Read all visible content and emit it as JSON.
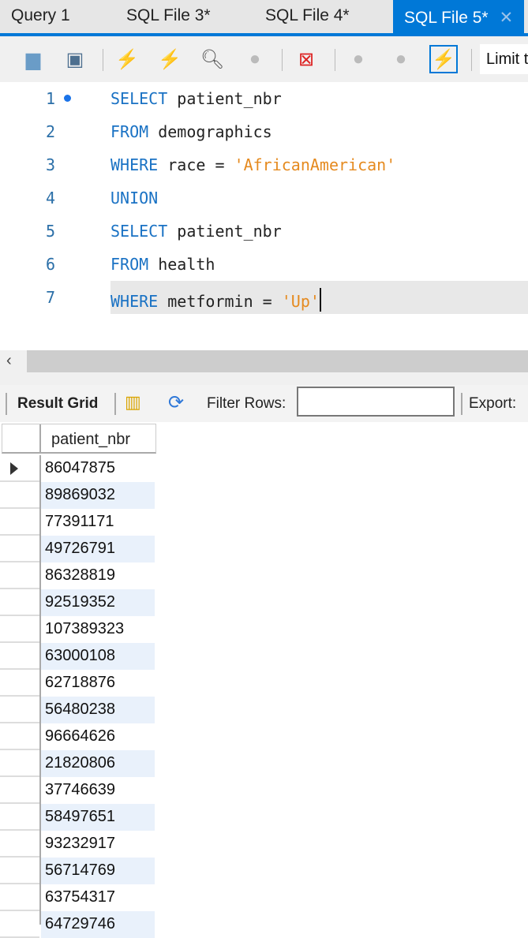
{
  "tabs": [
    {
      "label": "Query 1"
    },
    {
      "label": "SQL File 3*"
    },
    {
      "label": "SQL File 4*"
    },
    {
      "label": "SQL File 5*",
      "active": true
    }
  ],
  "toolbar": {
    "icons": [
      "open-folder-icon",
      "save-icon",
      "execute-icon",
      "execute-current-icon",
      "explain-icon",
      "stop-icon",
      "toggle-error-icon",
      "commit-icon",
      "rollback-icon",
      "autocommit-icon"
    ],
    "limit_label": "Limit t"
  },
  "editor": {
    "lines": [
      {
        "n": "1",
        "tokens": [
          [
            "kw",
            "SELECT"
          ],
          [
            "",
            "patient_nbr"
          ]
        ]
      },
      {
        "n": "2",
        "tokens": [
          [
            "kw",
            "FROM"
          ],
          [
            "",
            "demographics"
          ]
        ]
      },
      {
        "n": "3",
        "tokens": [
          [
            "kw",
            "WHERE"
          ],
          [
            "",
            "race ="
          ],
          [
            "str",
            "'AfricanAmerican'"
          ]
        ]
      },
      {
        "n": "4",
        "tokens": [
          [
            "kw",
            "UNION"
          ]
        ]
      },
      {
        "n": "5",
        "tokens": [
          [
            "kw",
            "SELECT"
          ],
          [
            "",
            "patient_nbr"
          ]
        ]
      },
      {
        "n": "6",
        "tokens": [
          [
            "kw",
            "FROM"
          ],
          [
            "",
            "health"
          ]
        ]
      },
      {
        "n": "7",
        "tokens": [
          [
            "kw",
            "WHERE"
          ],
          [
            "",
            "metformin ="
          ],
          [
            "str",
            "'Up'"
          ]
        ]
      }
    ]
  },
  "result_toolbar": {
    "result_grid": "Result Grid",
    "filter_rows": "Filter Rows:",
    "filter_value": "",
    "export": "Export:"
  },
  "grid": {
    "column": "patient_nbr",
    "rows": [
      "86047875",
      "89869032",
      "77391171",
      "49726791",
      "86328819",
      "92519352",
      "107389323",
      "63000108",
      "62718876",
      "56480238",
      "96664626",
      "21820806",
      "37746639",
      "58497651",
      "93232917",
      "56714769",
      "63754317",
      "64729746"
    ]
  },
  "colors": {
    "accent": "#0078d7",
    "keyword": "#1a72c4",
    "string": "#e58a1f",
    "alt_row": "#e9f1fb"
  }
}
